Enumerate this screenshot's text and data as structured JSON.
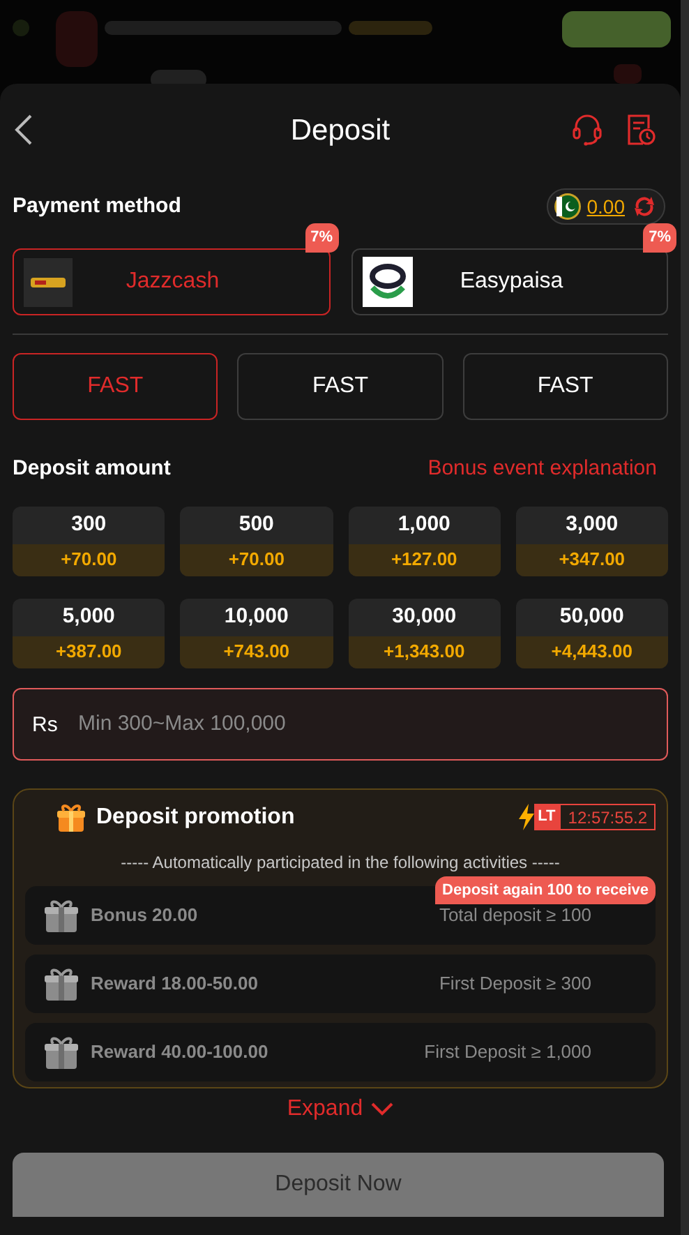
{
  "header": {
    "title": "Deposit"
  },
  "payment_method": {
    "label": "Payment method",
    "balance": "0.00"
  },
  "methods": [
    {
      "name": "Jazzcash",
      "badge": "7%",
      "selected": true
    },
    {
      "name": "Easypaisa",
      "badge": "7%",
      "selected": false
    }
  ],
  "channels": [
    {
      "label": "FAST",
      "selected": true
    },
    {
      "label": "FAST",
      "selected": false
    },
    {
      "label": "FAST",
      "selected": false
    }
  ],
  "deposit_amount": {
    "label": "Deposit amount",
    "link": "Bonus event explanation"
  },
  "amounts": [
    {
      "amount": "300",
      "bonus": "+70.00"
    },
    {
      "amount": "500",
      "bonus": "+70.00"
    },
    {
      "amount": "1,000",
      "bonus": "+127.00"
    },
    {
      "amount": "3,000",
      "bonus": "+347.00"
    },
    {
      "amount": "5,000",
      "bonus": "+387.00"
    },
    {
      "amount": "10,000",
      "bonus": "+743.00"
    },
    {
      "amount": "30,000",
      "bonus": "+1,343.00"
    },
    {
      "amount": "50,000",
      "bonus": "+4,443.00"
    }
  ],
  "amount_field": {
    "prefix": "Rs",
    "placeholder": "Min 300~Max 100,000"
  },
  "promotion": {
    "title": "Deposit promotion",
    "tag": "LT",
    "timer": "12:57:55.2",
    "note": "----- Automatically participated in the following activities -----",
    "rows": [
      {
        "title": "Bonus 20.00",
        "condition": "Total deposit ≥ 100",
        "tip": "Deposit again 100 to receive"
      },
      {
        "title": "Reward 18.00-50.00",
        "condition": "First Deposit ≥ 300"
      },
      {
        "title": "Reward 40.00-100.00",
        "condition": "First Deposit ≥ 1,000"
      }
    ]
  },
  "expand": "Expand",
  "submit": {
    "label": "Deposit Now",
    "disabled": true
  }
}
